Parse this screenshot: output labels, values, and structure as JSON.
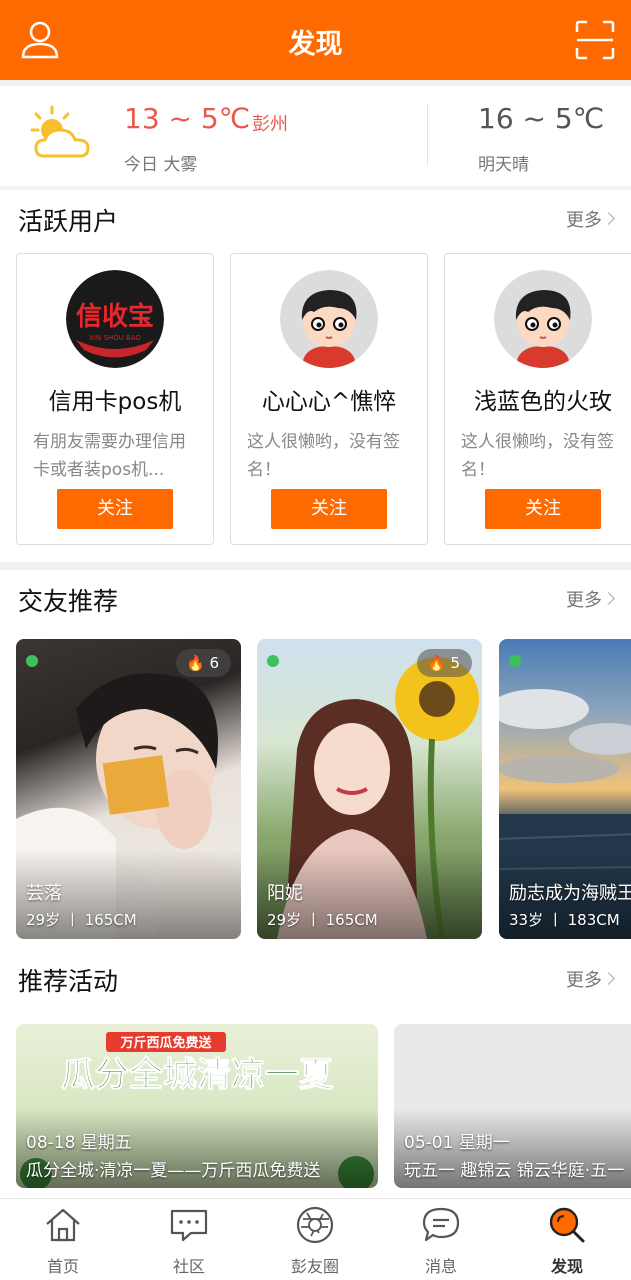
{
  "header": {
    "title": "发现"
  },
  "weather": {
    "today_temp": "13 ~ 5℃",
    "city": "彭州",
    "today_desc": "今日 大雾",
    "tomorrow_temp": "16 ~ 5℃",
    "tomorrow_desc": "明天晴"
  },
  "active_users": {
    "title": "活跃用户",
    "more": "更多",
    "users": [
      {
        "name": "信用卡pos机",
        "signature": "有朋友需要办理信用卡或者装pos机...",
        "follow": "关注",
        "logo_text": "信收宝",
        "logo_sub": "XIN SHOU BAO"
      },
      {
        "name": "心心心^憔悴",
        "signature": "这人很懒哟，没有签名！",
        "follow": "关注"
      },
      {
        "name": "浅蓝色的火玫",
        "signature": "这人很懒哟，没有签名！",
        "follow": "关注"
      }
    ]
  },
  "friends": {
    "title": "交友推荐",
    "more": "更多",
    "cards": [
      {
        "name": "芸落",
        "info": "29岁 丨 165CM",
        "hot": "6"
      },
      {
        "name": "阳妮",
        "info": "29岁 丨 165CM",
        "hot": "5"
      },
      {
        "name": "励志成为海贼王",
        "info": "33岁 丨 183CM"
      }
    ]
  },
  "events": {
    "title": "推荐活动",
    "more": "更多",
    "cards": [
      {
        "date": "08-18 星期五",
        "title": "瓜分全城·清凉一夏——万斤西瓜免费送",
        "banner_top": "万斤西瓜免费送",
        "banner_main": "瓜分全城清凉一夏"
      },
      {
        "date": "05-01 星期一",
        "title": "玩五一 趣锦云 锦云华庭·五一"
      }
    ]
  },
  "nav": [
    {
      "label": "首页",
      "icon": "home-icon"
    },
    {
      "label": "社区",
      "icon": "community-icon"
    },
    {
      "label": "彭友圈",
      "icon": "aperture-icon"
    },
    {
      "label": "消息",
      "icon": "message-icon"
    },
    {
      "label": "发现",
      "icon": "discover-icon",
      "active": true
    }
  ],
  "colors": {
    "brand": "#ff6a00",
    "temp_today": "#e85a4f",
    "online": "#3cc25a"
  }
}
